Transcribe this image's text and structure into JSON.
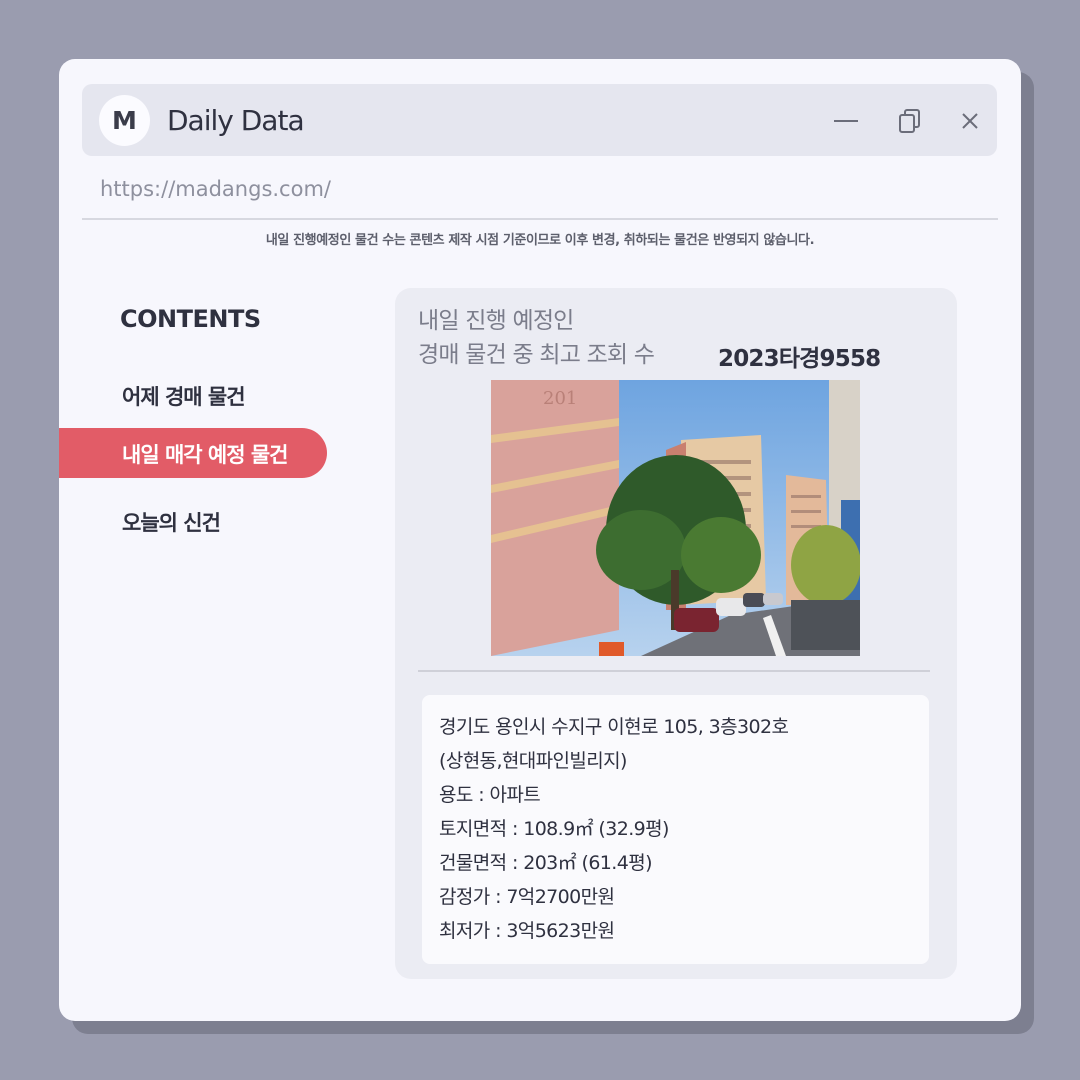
{
  "app": {
    "logo_letter": "M",
    "title": "Daily Data",
    "url": "https://madangs.com/"
  },
  "window_controls": {
    "minimize_icon": "minimize-icon",
    "restore_icon": "copy-icon",
    "close_icon": "close-icon"
  },
  "notice": "내일 진행예정인 물건 수는 콘텐츠 제작 시점 기준이므로 이후 변경, 취하되는 물건은 반영되지 않습니다.",
  "sidebar": {
    "title": "CONTENTS",
    "items": [
      {
        "label": "어제 경매 물건",
        "active": false
      },
      {
        "label": "내일 매각 예정 물건",
        "active": true
      },
      {
        "label": "오늘의 신건",
        "active": false
      }
    ]
  },
  "card": {
    "heading_line1": "내일 진행 예정인",
    "heading_line2": "경매 물건 중 최고 조회 수",
    "case_number": "2023타경9558",
    "details": [
      "경기도 용인시 수지구 이현로 105, 3층302호",
      "(상현동,현대파인빌리지)",
      "용도 : 아파트",
      "토지면적 : 108.9㎡ (32.9평)",
      "건물면적 : 203㎡ (61.4평)",
      "감정가 : 7억2700만원",
      "최저가 : 3억5623만원"
    ]
  },
  "colors": {
    "accent": "#e25c67",
    "background": "#9a9caf",
    "window": "#f7f7fd"
  }
}
